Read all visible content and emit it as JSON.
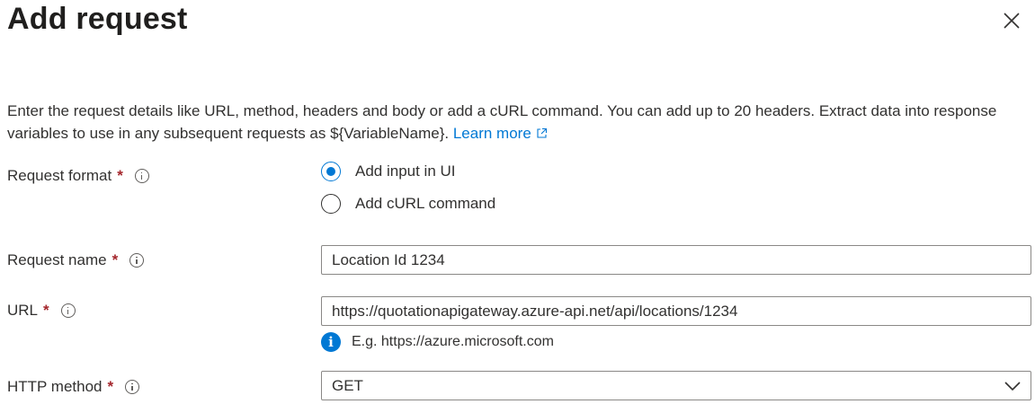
{
  "panel": {
    "title": "Add request",
    "description": "Enter the request details like URL, method, headers and body or add a cURL command. You can add up to 20 headers. Extract data into response variables to use in any subsequent requests as ${VariableName}.",
    "learn_more": "Learn more"
  },
  "form": {
    "request_format": {
      "label": "Request format",
      "required_mark": "*",
      "options": [
        "Add input in UI",
        "Add cURL command"
      ],
      "selected": "Add input in UI"
    },
    "request_name": {
      "label": "Request name",
      "required_mark": "*",
      "value": "Location Id 1234"
    },
    "url": {
      "label": "URL",
      "required_mark": "*",
      "value": "https://quotationapigateway.azure-api.net/api/locations/1234",
      "hint": "E.g. https://azure.microsoft.com"
    },
    "http_method": {
      "label": "HTTP method",
      "required_mark": "*",
      "value": "GET"
    }
  },
  "colors": {
    "accent": "#0078d4",
    "required": "#a4262c",
    "text": "#323130"
  },
  "icons": [
    "close-icon",
    "info-icon",
    "external-link-icon",
    "info-filled-icon",
    "chevron-down-icon"
  ]
}
